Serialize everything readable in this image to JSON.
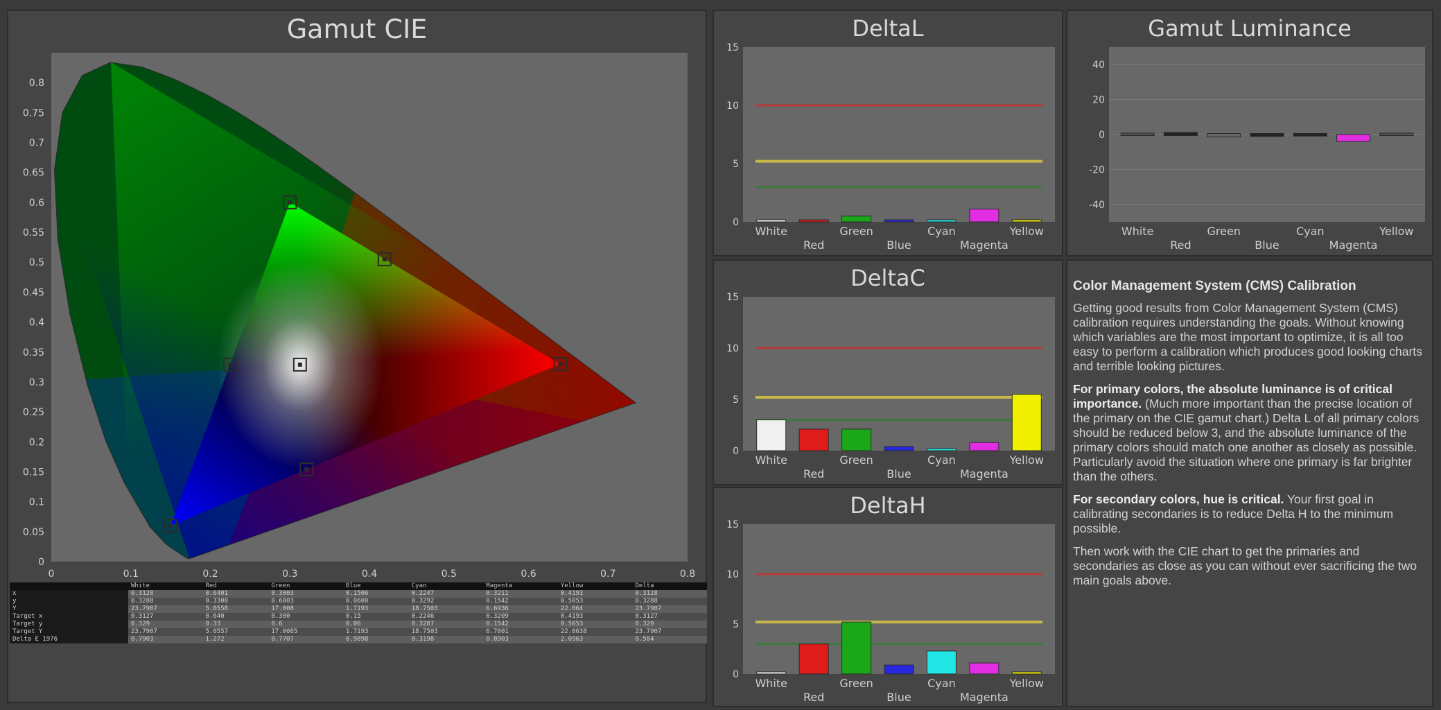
{
  "cie": {
    "title": "Gamut CIE",
    "y_ticks": [
      "0.8",
      "0.75",
      "0.7",
      "0.65",
      "0.6",
      "0.55",
      "0.5",
      "0.45",
      "0.4",
      "0.35",
      "0.3",
      "0.25",
      "0.2",
      "0.15",
      "0.1",
      "0.05",
      "0"
    ],
    "x_ticks": [
      "0",
      "0.1",
      "0.2",
      "0.3",
      "0.4",
      "0.5",
      "0.6",
      "0.7",
      "0.8"
    ],
    "targets": [
      {
        "name": "red",
        "x": 0.64,
        "y": 0.33
      },
      {
        "name": "green",
        "x": 0.3,
        "y": 0.6
      },
      {
        "name": "blue",
        "x": 0.15,
        "y": 0.06
      },
      {
        "name": "white",
        "x": 0.3127,
        "y": 0.329
      },
      {
        "name": "cyan",
        "x": 0.225,
        "y": 0.329
      },
      {
        "name": "magenta",
        "x": 0.321,
        "y": 0.154
      },
      {
        "name": "yellow",
        "x": 0.419,
        "y": 0.505
      }
    ]
  },
  "table": {
    "headers": [
      "",
      "White",
      "Red",
      "Green",
      "Blue",
      "Cyan",
      "Magenta",
      "Yellow",
      "Delta"
    ],
    "rows": [
      [
        "x",
        "0.3128",
        "0.6401",
        "0.3003",
        "0.1506",
        "0.2247",
        "0.3211",
        "0.4193",
        "0.3128"
      ],
      [
        "y",
        "0.3288",
        "0.3300",
        "0.6003",
        "0.0600",
        "0.3292",
        "0.1542",
        "0.5053",
        "0.3288"
      ],
      [
        "Y",
        "23.7907",
        "5.0558",
        "17.008",
        "1.7193",
        "18.7503",
        "6.6936",
        "22.064",
        "23.7907"
      ],
      [
        "Target x",
        "0.3127",
        "0.640",
        "0.300",
        "0.15",
        "0.2246",
        "0.3209",
        "0.4193",
        "0.3127"
      ],
      [
        "Target y",
        "0.329",
        "0.33",
        "0.6",
        "0.06",
        "0.3287",
        "0.1542",
        "0.5053",
        "0.329"
      ],
      [
        "Target Y",
        "23.7907",
        "5.0557",
        "17.0085",
        "1.7193",
        "18.7503",
        "6.7001",
        "22.0638",
        "23.7907"
      ],
      [
        "Delta E 1976",
        "0.7903",
        "1.272",
        "0.7707",
        "0.9898",
        "0.3198",
        "0.8903",
        "2.0963",
        "0.504"
      ]
    ]
  },
  "deltaL": {
    "title": "DeltaL",
    "y_max": 15,
    "y_ticks": [
      "15",
      "10",
      "5",
      "0"
    ],
    "ref_lines": [
      10,
      5.2,
      3
    ],
    "cats_top": [
      "White",
      "Green",
      "Cyan",
      "Yellow"
    ],
    "cats_bottom": [
      "Red",
      "Blue",
      "Magenta"
    ],
    "values": [
      0.1,
      0.1,
      0.5,
      0.1,
      0.1,
      1.1,
      0.1
    ],
    "colors": [
      "#f0f0f0",
      "#e01b1b",
      "#1aa81a",
      "#2727e0",
      "#22e6e6",
      "#e22ee2",
      "#f0f000"
    ]
  },
  "lum": {
    "title": "Gamut Luminance",
    "y_ticks": [
      "40",
      "20",
      "0",
      "-20",
      "-40"
    ],
    "y_min": -50,
    "y_max": 50,
    "cats_top": [
      "White",
      "Green",
      "Cyan",
      "Yellow"
    ],
    "cats_bottom": [
      "Red",
      "Blue",
      "Magenta"
    ],
    "values": [
      0.2,
      0.6,
      -0.8,
      -0.5,
      -0.3,
      -4,
      0.2
    ],
    "colors": [
      "#555555",
      "#222222",
      "#666666",
      "#222222",
      "#222222",
      "#e22ee2",
      "#555555"
    ]
  },
  "deltaC": {
    "title": "DeltaC",
    "y_max": 15,
    "y_ticks": [
      "15",
      "10",
      "5",
      "0"
    ],
    "ref_lines": [
      10,
      5.2,
      3
    ],
    "cats_top": [
      "White",
      "Green",
      "Cyan",
      "Yellow"
    ],
    "cats_bottom": [
      "Red",
      "Blue",
      "Magenta"
    ],
    "values": [
      3.0,
      2.1,
      2.1,
      0.4,
      0.1,
      0.8,
      5.5
    ],
    "colors": [
      "#f0f0f0",
      "#e01b1b",
      "#1aa81a",
      "#2727e0",
      "#22e6e6",
      "#e22ee2",
      "#f0f000"
    ]
  },
  "deltaH": {
    "title": "DeltaH",
    "y_max": 15,
    "y_ticks": [
      "15",
      "10",
      "5",
      "0"
    ],
    "ref_lines": [
      10,
      5.2,
      3
    ],
    "cats_top": [
      "White",
      "Green",
      "Cyan",
      "Yellow"
    ],
    "cats_bottom": [
      "Red",
      "Blue",
      "Magenta"
    ],
    "values": [
      0.1,
      3.0,
      5.2,
      0.9,
      2.3,
      1.1,
      0.1
    ],
    "colors": [
      "#f0f0f0",
      "#e01b1b",
      "#1aa81a",
      "#2727e0",
      "#22e6e6",
      "#e22ee2",
      "#f0f000"
    ]
  },
  "cms": {
    "heading": "Color Management System (CMS) Calibration",
    "p1": "Getting good results from Color Management System (CMS) calibration requires understanding the goals. Without knowing which variables are the most important to optimize, it is all too easy to perform a calibration which produces good looking charts and terrible looking pictures.",
    "p2_bold": "For primary colors, the absolute luminance is of critical importance.",
    "p2_rest": " (Much more important than the precise location of the primary on the CIE gamut chart.) Delta L of all primary colors should be reduced below 3, and the absolute luminance of the primary colors should match one another as closely as possible. Particularly avoid the situation where one primary is far brighter than the others.",
    "p3_bold": "For secondary colors, hue is critical.",
    "p3_rest": " Your first goal in calibrating secondaries is to reduce Delta H to the minimum possible.",
    "p4": "Then work with the CIE chart to get the primaries and secondaries as close as you can without ever sacrificing the two main goals above."
  }
}
